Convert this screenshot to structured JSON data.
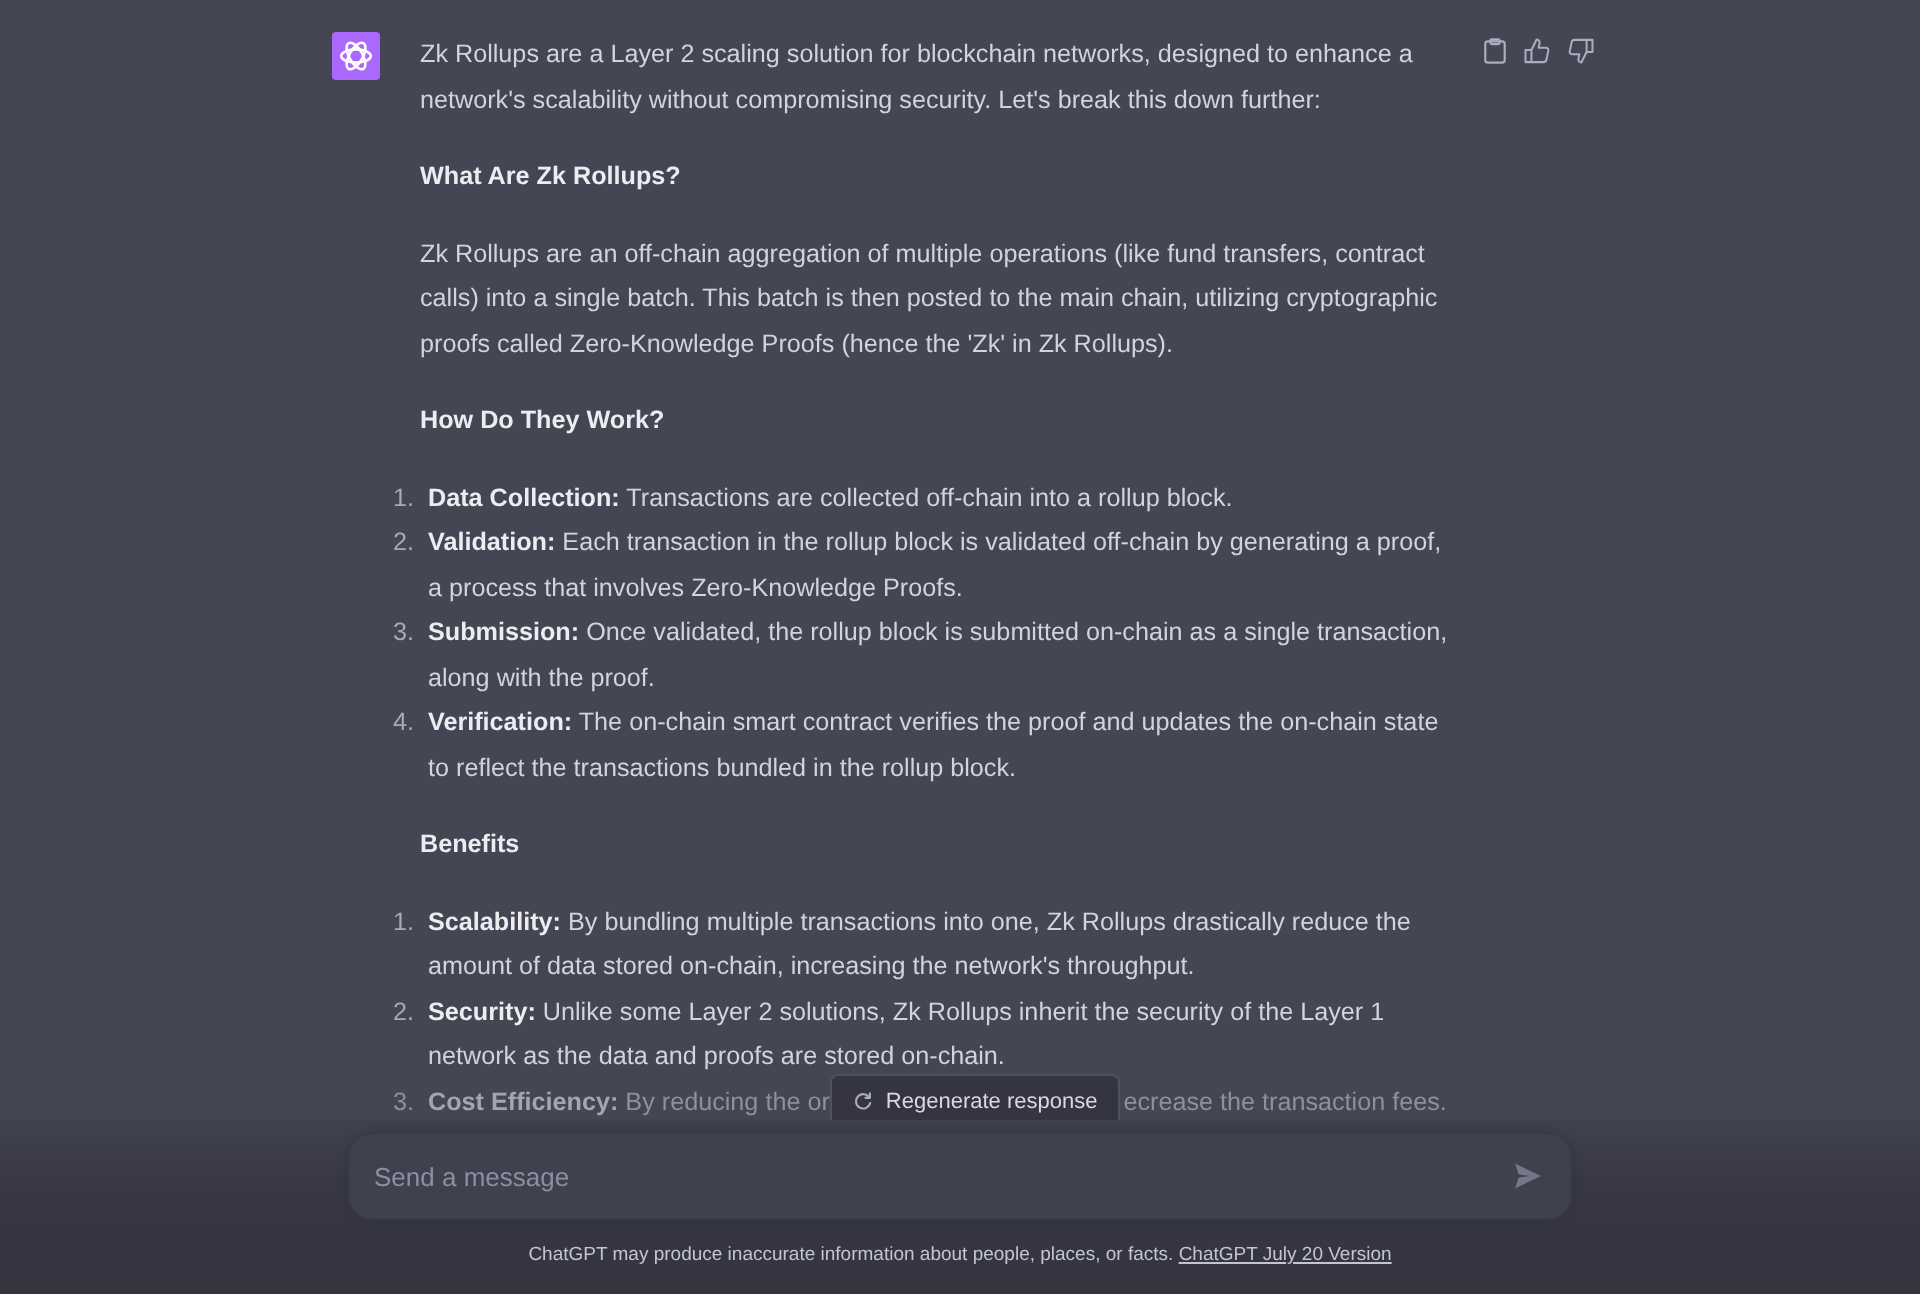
{
  "message": {
    "blocks": [
      {
        "kind": "paragraph",
        "text": "Zk Rollups are a Layer 2 scaling solution for blockchain networks, designed to enhance a network's scalability without compromising security. Let's break this down further:"
      },
      {
        "kind": "heading",
        "text": "What Are Zk Rollups?"
      },
      {
        "kind": "paragraph",
        "text": "Zk Rollups are an off-chain aggregation of multiple operations (like fund transfers, contract calls) into a single batch. This batch is then posted to the main chain, utilizing cryptographic proofs called Zero-Knowledge Proofs (hence the 'Zk' in Zk Rollups)."
      },
      {
        "kind": "heading",
        "text": "How Do They Work?"
      },
      {
        "kind": "list",
        "items": [
          {
            "number": "1.",
            "text": "**Data Collection:** Transactions are collected off-chain into a rollup block."
          },
          {
            "number": "2.",
            "text": "**Validation:** Each transaction in the rollup block is validated off-chain by generating a proof, a process that involves Zero-Knowledge Proofs."
          },
          {
            "number": "3.",
            "text": "**Submission:** Once validated, the rollup block is submitted on-chain as a single transaction, along with the proof."
          },
          {
            "number": "4.",
            "text": "**Verification:** The on-chain smart contract verifies the proof and updates the on-chain state to reflect the transactions bundled in the rollup block."
          }
        ]
      },
      {
        "kind": "heading",
        "text": "Benefits"
      },
      {
        "kind": "list",
        "items": [
          {
            "number": "1.",
            "text": "**Scalability:** By bundling multiple transactions into one, Zk Rollups drastically reduce the amount of data stored on-chain, increasing the network's throughput."
          },
          {
            "number": "2.",
            "text": "**Security:** Unlike some Layer 2 solutions, Zk Rollups inherit the security of the Layer 1 network as the data and proofs are stored on-chain."
          },
          {
            "number": "3.",
            "text": "**Cost Efficiency:** By reducing the or",
            "text_after": "ecrease the transaction fees."
          }
        ]
      }
    ]
  },
  "regenerate_button": {
    "label": "Regenerate response"
  },
  "composer": {
    "placeholder": "Send a message"
  },
  "footer": {
    "text": "ChatGPT may produce inaccurate information about people, places, or facts.",
    "link": "ChatGPT July 20 Version"
  }
}
